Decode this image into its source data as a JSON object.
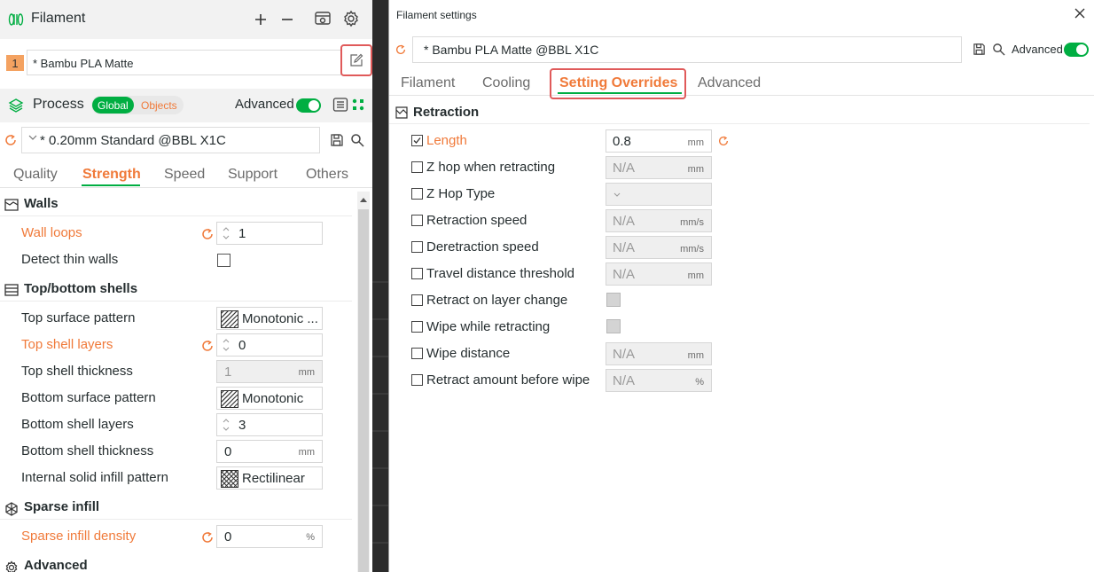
{
  "filament": {
    "title": "Filament",
    "slot_number": "1",
    "selected": "* Bambu PLA Matte"
  },
  "process": {
    "title": "Process",
    "pill_global": "Global",
    "pill_objects": "Objects",
    "advanced_label": "Advanced",
    "preset": "* 0.20mm Standard @BBL X1C",
    "tabs": [
      "Quality",
      "Strength",
      "Speed",
      "Support",
      "Others"
    ]
  },
  "sections": {
    "walls": "Walls",
    "top_bottom": "Top/bottom shells",
    "sparse": "Sparse infill",
    "advanced": "Advanced"
  },
  "options": {
    "wall_loops": {
      "label": "Wall loops",
      "value": "1"
    },
    "detect_thin_walls": {
      "label": "Detect thin walls"
    },
    "top_surface_pattern": {
      "label": "Top surface pattern",
      "value": "Monotonic ..."
    },
    "top_shell_layers": {
      "label": "Top shell layers",
      "value": "0"
    },
    "top_shell_thickness": {
      "label": "Top shell thickness",
      "value": "1",
      "unit": "mm"
    },
    "bottom_surface_pattern": {
      "label": "Bottom surface pattern",
      "value": "Monotonic"
    },
    "bottom_shell_layers": {
      "label": "Bottom shell layers",
      "value": "3"
    },
    "bottom_shell_thickness": {
      "label": "Bottom shell thickness",
      "value": "0",
      "unit": "mm"
    },
    "internal_solid_infill": {
      "label": "Internal solid infill pattern",
      "value": "Rectilinear"
    },
    "sparse_density": {
      "label": "Sparse infill density",
      "value": "0",
      "unit": "%"
    }
  },
  "dialog": {
    "title": "Filament settings",
    "preset": "* Bambu PLA Matte @BBL X1C",
    "advanced_label": "Advanced",
    "tabs": [
      "Filament",
      "Cooling",
      "Setting Overrides",
      "Advanced"
    ],
    "section": "Retraction",
    "rows": [
      {
        "label": "Length",
        "value": "0.8",
        "unit": "mm"
      },
      {
        "label": "Z hop when retracting",
        "value": "N/A",
        "unit": "mm"
      },
      {
        "label": "Z Hop Type",
        "value": "",
        "unit": ""
      },
      {
        "label": "Retraction speed",
        "value": "N/A",
        "unit": "mm/s"
      },
      {
        "label": "Deretraction speed",
        "value": "N/A",
        "unit": "mm/s"
      },
      {
        "label": "Travel distance threshold",
        "value": "N/A",
        "unit": "mm"
      },
      {
        "label": "Retract on layer change"
      },
      {
        "label": "Wipe while retracting"
      },
      {
        "label": "Wipe distance",
        "value": "N/A",
        "unit": "mm"
      },
      {
        "label": "Retract amount before wipe",
        "value": "N/A",
        "unit": "%"
      }
    ]
  },
  "colors": {
    "accent_orange": "#f07a3a",
    "brand_green": "#00ae42",
    "highlight_red": "#e05a5a"
  }
}
